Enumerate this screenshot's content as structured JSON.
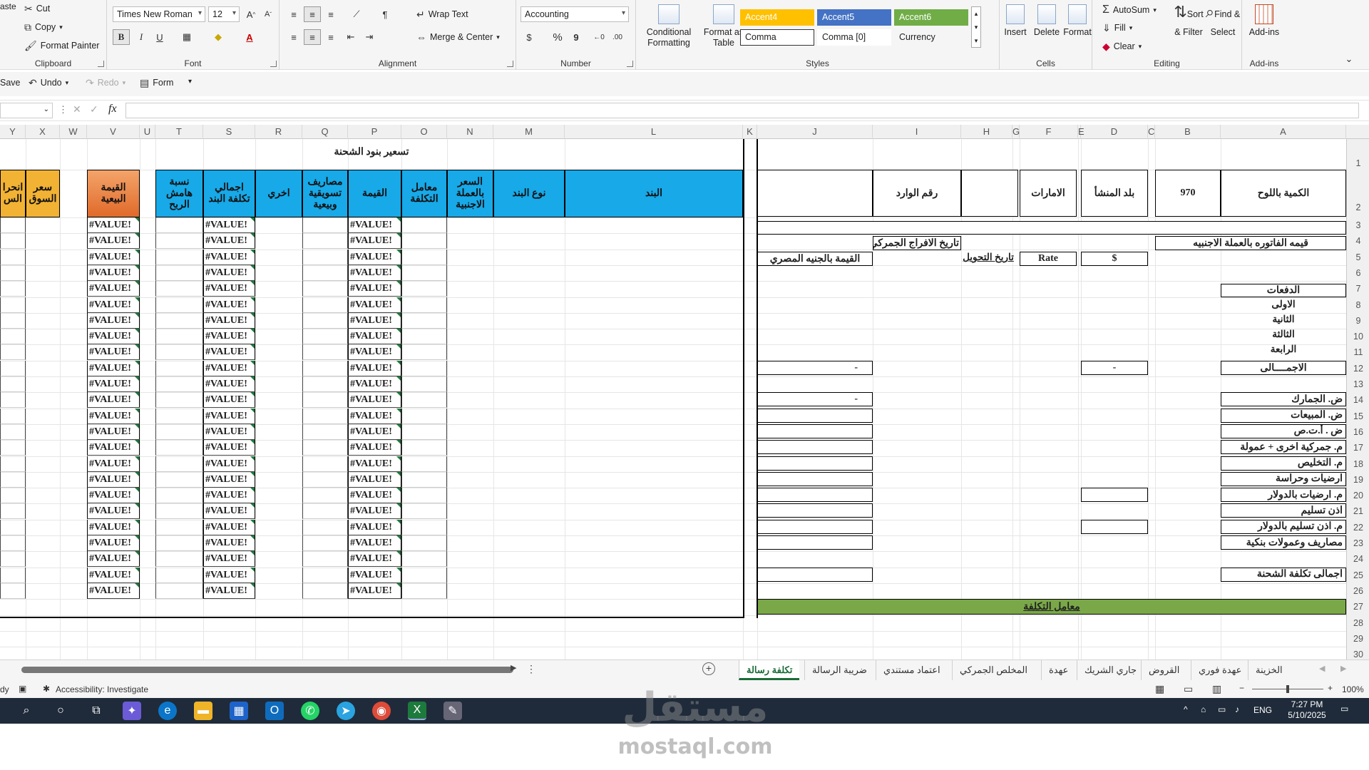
{
  "ribbon": {
    "clipboard": {
      "paste": "aste",
      "cut": "Cut",
      "copy": "Copy",
      "format_painter": "Format Painter",
      "label": "Clipboard"
    },
    "font": {
      "name": "Times New Roman",
      "size": "12",
      "label": "Font",
      "bold": "B",
      "italic": "I",
      "underline": "U",
      "grow": "A^",
      "shrink": "Aˇ"
    },
    "alignment": {
      "wrap_text": "Wrap Text",
      "merge_center": "Merge & Center",
      "label": "Alignment"
    },
    "number": {
      "format": "Accounting",
      "currency": "$",
      "percent": "%",
      "comma": "9",
      "label": "Number"
    },
    "styles": {
      "conditional": "Conditional Formatting",
      "format_table": "Format as Table",
      "label": "Styles",
      "cells": [
        {
          "name": "Accent4",
          "bg": "#ffc000"
        },
        {
          "name": "Accent5",
          "bg": "#4472c4"
        },
        {
          "name": "Accent6",
          "bg": "#70ad47"
        },
        {
          "name": "Comma",
          "bg": "#ffffff"
        },
        {
          "name": "Comma [0]",
          "bg": "#ffffff"
        },
        {
          "name": "Currency",
          "bg": "#ffffff"
        }
      ]
    },
    "cells": {
      "insert": "Insert",
      "delete": "Delete",
      "format": "Format",
      "label": "Cells"
    },
    "editing": {
      "autosum": "AutoSum",
      "fill": "Fill",
      "clear": "Clear",
      "sort_filter": "Sort & Filter",
      "find_select": "Find & Select",
      "label": "Editing"
    },
    "addins": {
      "addins": "Add-ins",
      "label": "Add-ins"
    }
  },
  "qat": {
    "save": "Save",
    "undo": "Undo",
    "redo": "Redo",
    "form": "Form"
  },
  "formula_bar": {
    "fx": "fx",
    "value": ""
  },
  "columns": [
    "Y",
    "X",
    "W",
    "V",
    "U",
    "T",
    "S",
    "R",
    "Q",
    "P",
    "O",
    "N",
    "M",
    "L",
    "K",
    "J",
    "I",
    "H",
    "G",
    "F",
    "E",
    "D",
    "C",
    "B",
    "A"
  ],
  "rows": [
    "1",
    "2",
    "3",
    "4",
    "5",
    "6",
    "7",
    "8",
    "9",
    "10",
    "11",
    "12",
    "13",
    "14",
    "15",
    "16",
    "17",
    "18",
    "19",
    "20",
    "21",
    "22",
    "23",
    "24",
    "25",
    "26",
    "27",
    "28",
    "29",
    "30"
  ],
  "left_table": {
    "title": "تسعير بنود الشحنة",
    "headers": {
      "l": "البند",
      "m": "نوع البند",
      "n": "السعر بالعملة الاجنبية",
      "o": "معامل التكلفة",
      "p": "القيمة",
      "q": "مصاريف تسويقية وبيعية",
      "r": "اخري",
      "s": "اجمالي تكلفة البند",
      "t": "نسبة هامش الربح",
      "v": "القيمة البيعية",
      "x": "سعر السوق",
      "y": "انحرا الس"
    },
    "error_value": "#VALUE!"
  },
  "right_form": {
    "qty_label": "الكمية باللوح",
    "qty_value": "970",
    "origin": "بلد المنشأ",
    "uae": "الامارات",
    "incoming": "رقم الوارد",
    "invoice": "قيمه الفاتوره بالعملة الاجنبيه",
    "release_date": "تاريخ الافراج الجمركي",
    "dollar": "$",
    "rate": "Rate",
    "conversion_date": "تاريخ التحويل",
    "egp_value": "القيمة بالجنيه المصري",
    "payments": "الدفعات",
    "first": "الاولى",
    "second": "الثانية",
    "third": "الثالثة",
    "fourth": "الرابعة",
    "total": "الاجمــــالى",
    "dash": "-",
    "customs": "ض. الجمارك",
    "sales_tax": "ض. المبيعات",
    "tax3": "ض . أ.ت.ص",
    "customs_other": "م. جمركية اخرى + عمولة",
    "clearance": "م. التخليص",
    "storage": "ارضيات وحراسة",
    "storage_usd": "م. ارضيات بالدولار",
    "delivery": "اذن تسليم",
    "delivery_usd": "م. اذن تسليم بالدولار",
    "bank": "مصاريف وعمولات بنكية",
    "total_cost": "اجمالى تكلفة الشحنة",
    "cost_factor": "معامل التكلفة"
  },
  "sheet_tabs": [
    "الخزينة",
    "عهدة فوري",
    "القروض",
    "جاري الشريك",
    "عهدة",
    "المخلص الجمركي",
    "اعتماد مستندي",
    "ضريبة الرسالة",
    "تكلفة رسالة"
  ],
  "active_tab": "تكلفة رسالة",
  "status": {
    "ready": "dy",
    "accessibility": "Accessibility: Investigate",
    "zoom": "100%"
  },
  "taskbar": {
    "lang": "ENG",
    "time": "7:27 PM",
    "date": "5/10/2025"
  },
  "watermark": {
    "logo": "مستقل",
    "site": "mostaql.com"
  }
}
